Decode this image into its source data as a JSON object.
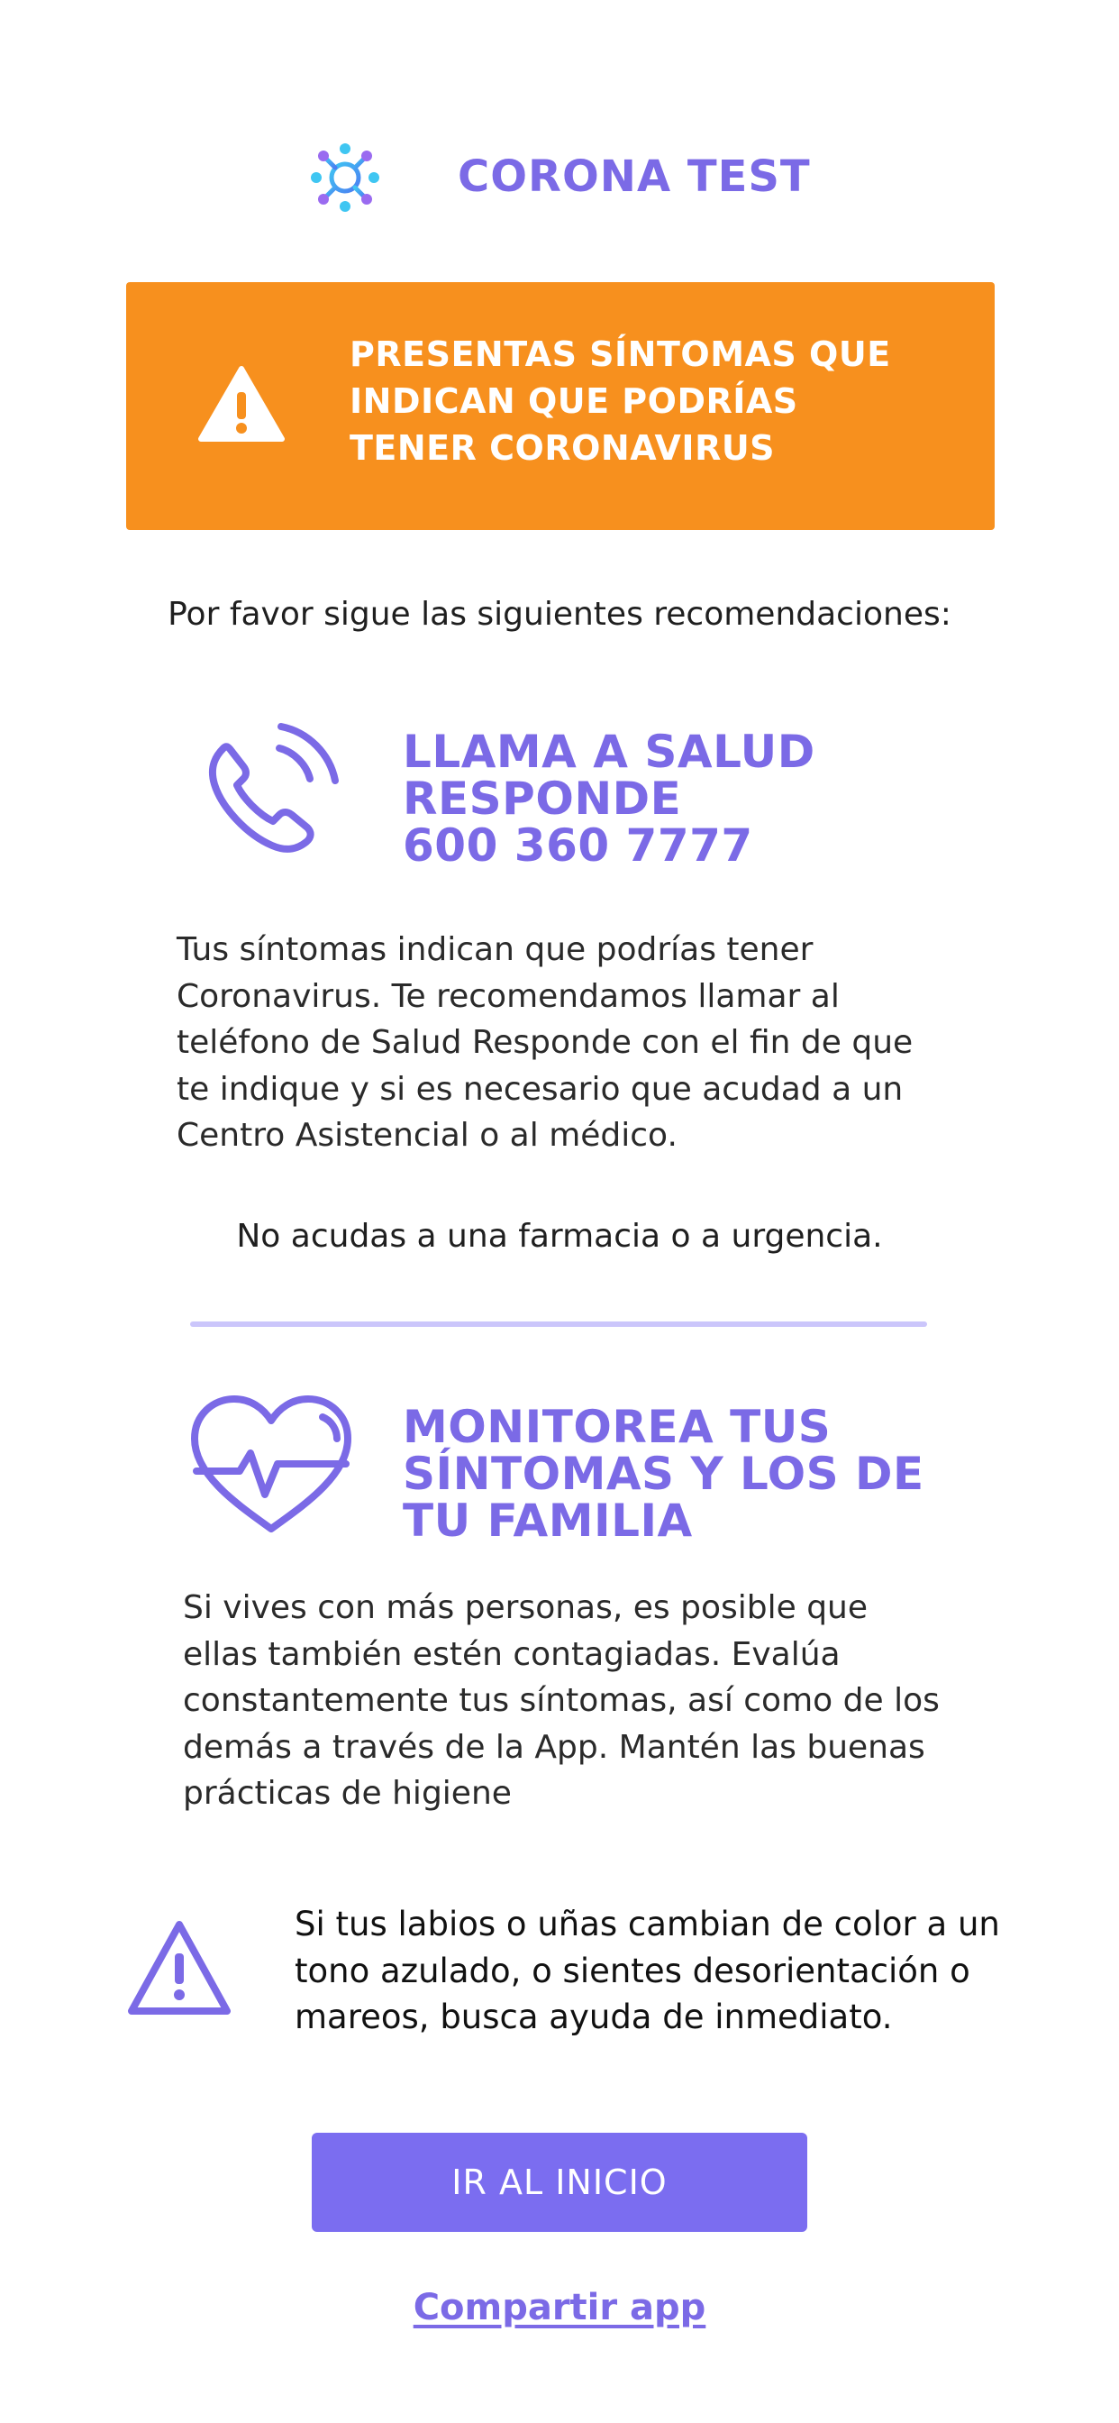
{
  "header": {
    "title": "CORONA TEST",
    "logo_icon": "virus-molecule-icon"
  },
  "alert_banner": {
    "icon": "warning-triangle-icon",
    "lines": [
      "PRESENTAS SÍNTOMAS QUE",
      "INDICAN QUE PODRÍAS",
      "TENER CORONAVIRUS"
    ],
    "background_color": "#f7901e"
  },
  "intro": "Por favor sigue las siguientes recomendaciones:",
  "section_call": {
    "icon": "phone-ringing-icon",
    "heading_lines": [
      "LLAMA A SALUD",
      "RESPONDE",
      "600 360 7777"
    ],
    "body_lines": [
      "Tus síntomas indican que podrías tener",
      "Coronavirus. Te recomendamos llamar al",
      "teléfono de Salud Responde con el fin de que",
      "te indique y si es necesario que acudad a un",
      "Centro Asistencial o al médico."
    ],
    "note": "No acudas a una farmacia o a urgencia."
  },
  "section_monitor": {
    "icon": "heart-pulse-icon",
    "heading_lines": [
      "MONITOREA TUS",
      "SÍNTOMAS Y LOS DE",
      "TU FAMILIA"
    ],
    "body_lines": [
      "Si vives con más personas, es posible que",
      "ellas también estén contagiadas. Evalúa",
      "constantemente tus síntomas, así como de los",
      "demás a través de la App. Mantén las buenas",
      "prácticas de higiene"
    ]
  },
  "warning": {
    "icon": "warning-triangle-outline-icon",
    "lines": [
      "Si tus labios o uñas cambian de color a un",
      "tono azulado, o sientes desorientación o",
      "mareos, busca ayuda de inmediato."
    ]
  },
  "actions": {
    "home_button_label": "IR AL INICIO",
    "share_link_label": "Compartir app"
  },
  "colors": {
    "accent": "#7b6ae6",
    "button": "#7b6df0",
    "divider": "#cbc6fb",
    "alert": "#f7901e"
  }
}
